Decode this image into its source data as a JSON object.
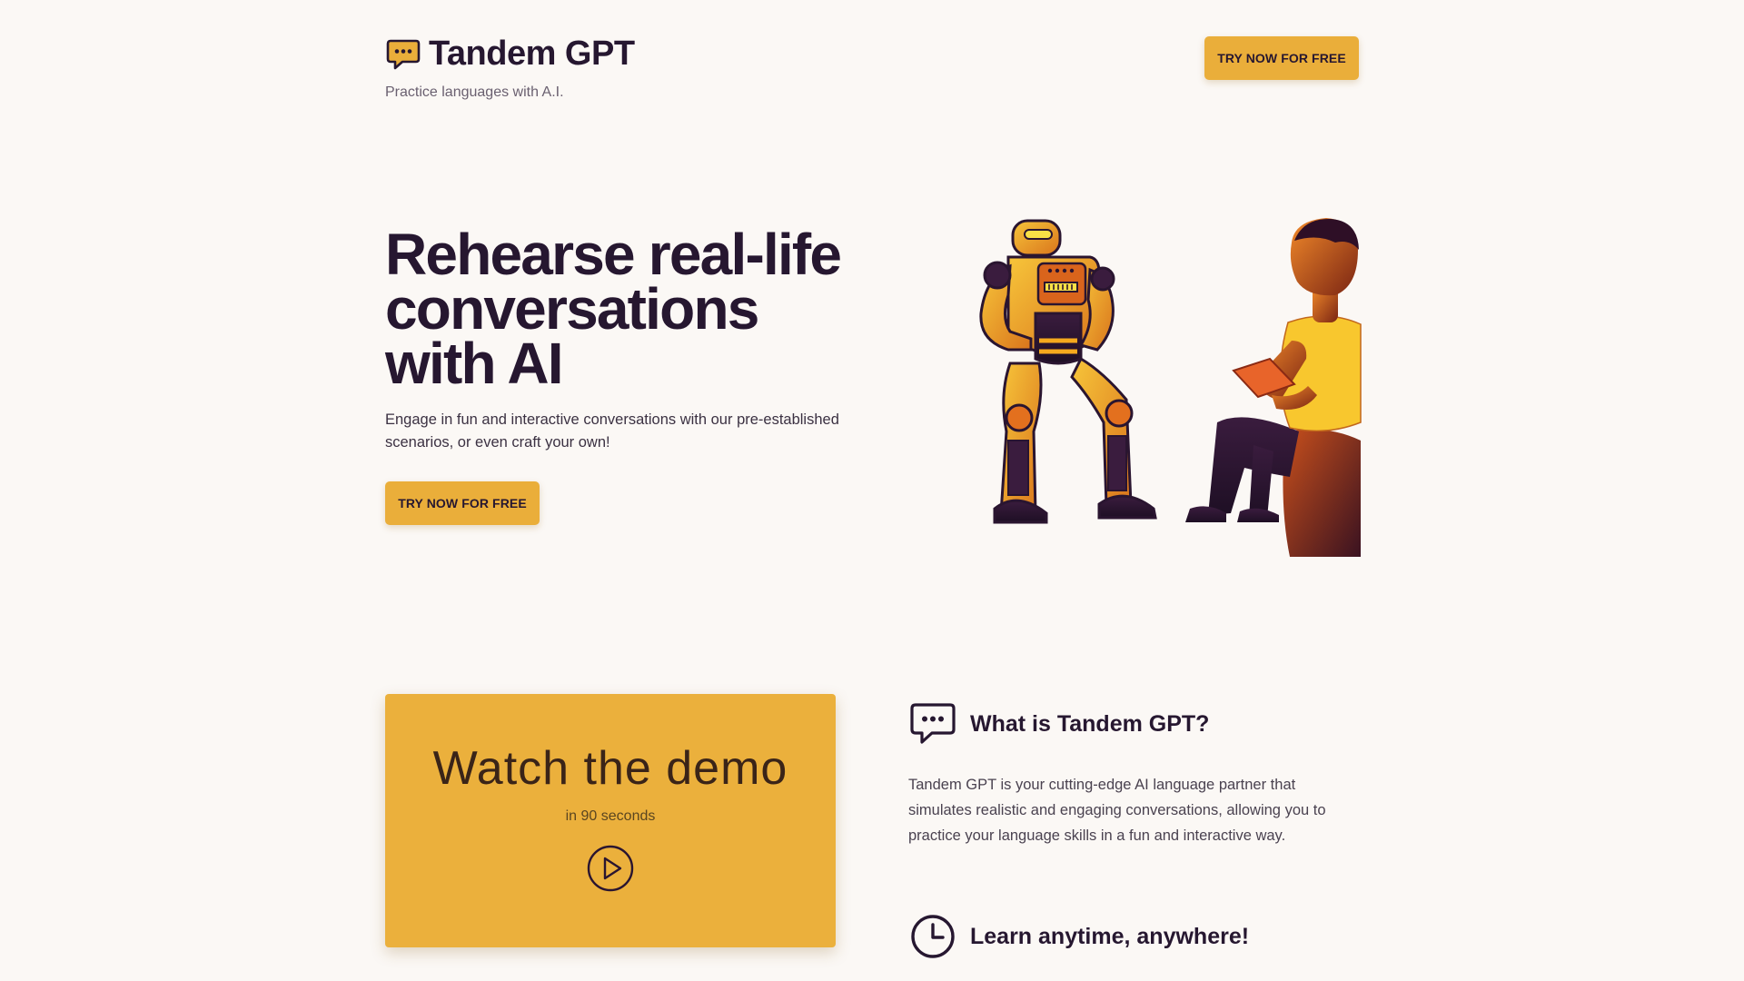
{
  "header": {
    "brand_name": "Tandem GPT",
    "tagline": "Practice languages with A.I.",
    "cta_label": "TRY NOW FOR FREE"
  },
  "hero": {
    "title_line1": "Rehearse real-life",
    "title_line2": "conversations",
    "title_line3": "with AI",
    "subtitle": "Engage in fun and interactive conversations with our pre-established scenarios, or even craft your own!",
    "cta_label": "TRY NOW FOR FREE",
    "illustration": "robot-and-person-illustration"
  },
  "demo": {
    "title": "Watch the demo",
    "subtitle": "in 90 seconds",
    "icon": "play-icon"
  },
  "features": [
    {
      "icon": "chat-bubble-icon",
      "title": "What is Tandem GPT?",
      "text": "Tandem GPT is your cutting-edge AI language partner that simulates realistic and engaging conversations, allowing you to practice your language skills in a fun and interactive way."
    },
    {
      "icon": "clock-icon",
      "title": "Learn anytime, anywhere!"
    }
  ],
  "colors": {
    "background": "#fbf8f5",
    "accent": "#eaae3a",
    "text_dark": "#261730"
  }
}
